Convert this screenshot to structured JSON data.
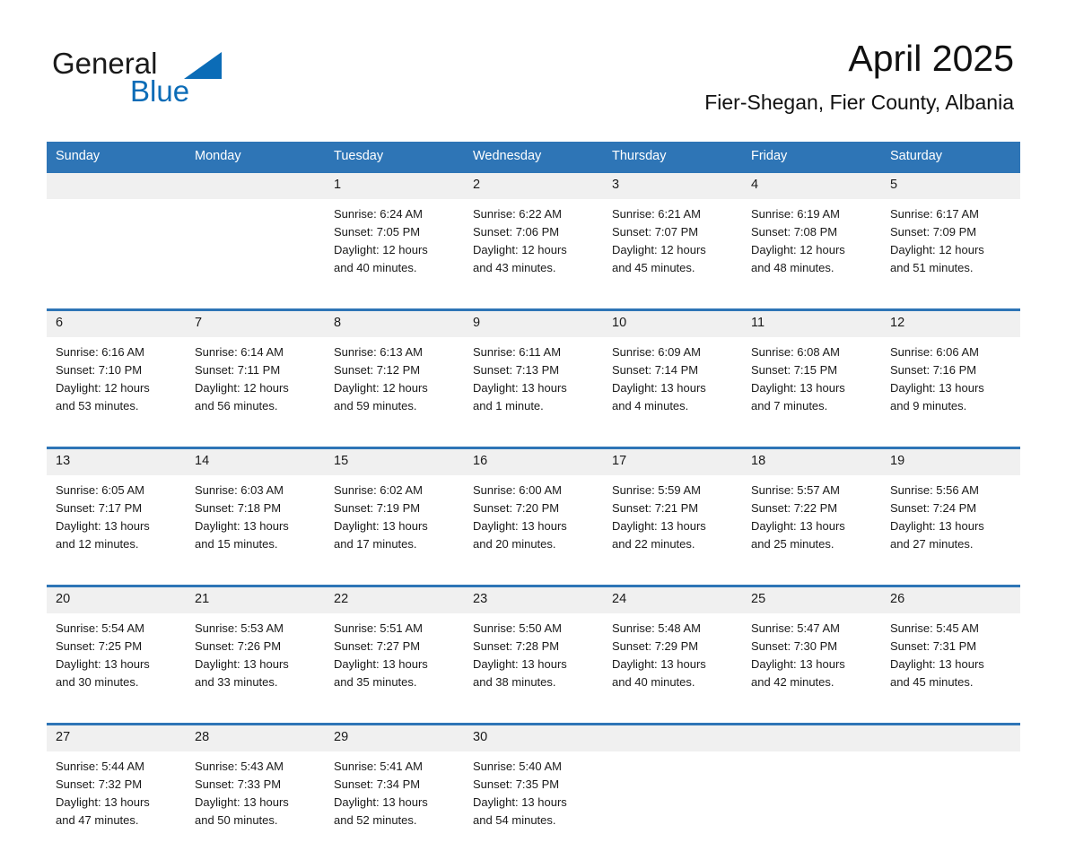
{
  "brand": {
    "name_part1": "General",
    "name_part2": "Blue",
    "triangle_icon": "triangle-icon",
    "accent_color": "#0b6cb7"
  },
  "header": {
    "title": "April 2025",
    "subtitle": "Fier-Shegan, Fier County, Albania"
  },
  "calendar": {
    "header_bg": "#2e75b6",
    "daynum_bg": "#f0f0f0",
    "weekdays": [
      "Sunday",
      "Monday",
      "Tuesday",
      "Wednesday",
      "Thursday",
      "Friday",
      "Saturday"
    ],
    "weeks": [
      [
        {
          "day": "",
          "sunrise": "",
          "sunset": "",
          "daylight1": "",
          "daylight2": ""
        },
        {
          "day": "",
          "sunrise": "",
          "sunset": "",
          "daylight1": "",
          "daylight2": ""
        },
        {
          "day": "1",
          "sunrise": "Sunrise: 6:24 AM",
          "sunset": "Sunset: 7:05 PM",
          "daylight1": "Daylight: 12 hours",
          "daylight2": "and 40 minutes."
        },
        {
          "day": "2",
          "sunrise": "Sunrise: 6:22 AM",
          "sunset": "Sunset: 7:06 PM",
          "daylight1": "Daylight: 12 hours",
          "daylight2": "and 43 minutes."
        },
        {
          "day": "3",
          "sunrise": "Sunrise: 6:21 AM",
          "sunset": "Sunset: 7:07 PM",
          "daylight1": "Daylight: 12 hours",
          "daylight2": "and 45 minutes."
        },
        {
          "day": "4",
          "sunrise": "Sunrise: 6:19 AM",
          "sunset": "Sunset: 7:08 PM",
          "daylight1": "Daylight: 12 hours",
          "daylight2": "and 48 minutes."
        },
        {
          "day": "5",
          "sunrise": "Sunrise: 6:17 AM",
          "sunset": "Sunset: 7:09 PM",
          "daylight1": "Daylight: 12 hours",
          "daylight2": "and 51 minutes."
        }
      ],
      [
        {
          "day": "6",
          "sunrise": "Sunrise: 6:16 AM",
          "sunset": "Sunset: 7:10 PM",
          "daylight1": "Daylight: 12 hours",
          "daylight2": "and 53 minutes."
        },
        {
          "day": "7",
          "sunrise": "Sunrise: 6:14 AM",
          "sunset": "Sunset: 7:11 PM",
          "daylight1": "Daylight: 12 hours",
          "daylight2": "and 56 minutes."
        },
        {
          "day": "8",
          "sunrise": "Sunrise: 6:13 AM",
          "sunset": "Sunset: 7:12 PM",
          "daylight1": "Daylight: 12 hours",
          "daylight2": "and 59 minutes."
        },
        {
          "day": "9",
          "sunrise": "Sunrise: 6:11 AM",
          "sunset": "Sunset: 7:13 PM",
          "daylight1": "Daylight: 13 hours",
          "daylight2": "and 1 minute."
        },
        {
          "day": "10",
          "sunrise": "Sunrise: 6:09 AM",
          "sunset": "Sunset: 7:14 PM",
          "daylight1": "Daylight: 13 hours",
          "daylight2": "and 4 minutes."
        },
        {
          "day": "11",
          "sunrise": "Sunrise: 6:08 AM",
          "sunset": "Sunset: 7:15 PM",
          "daylight1": "Daylight: 13 hours",
          "daylight2": "and 7 minutes."
        },
        {
          "day": "12",
          "sunrise": "Sunrise: 6:06 AM",
          "sunset": "Sunset: 7:16 PM",
          "daylight1": "Daylight: 13 hours",
          "daylight2": "and 9 minutes."
        }
      ],
      [
        {
          "day": "13",
          "sunrise": "Sunrise: 6:05 AM",
          "sunset": "Sunset: 7:17 PM",
          "daylight1": "Daylight: 13 hours",
          "daylight2": "and 12 minutes."
        },
        {
          "day": "14",
          "sunrise": "Sunrise: 6:03 AM",
          "sunset": "Sunset: 7:18 PM",
          "daylight1": "Daylight: 13 hours",
          "daylight2": "and 15 minutes."
        },
        {
          "day": "15",
          "sunrise": "Sunrise: 6:02 AM",
          "sunset": "Sunset: 7:19 PM",
          "daylight1": "Daylight: 13 hours",
          "daylight2": "and 17 minutes."
        },
        {
          "day": "16",
          "sunrise": "Sunrise: 6:00 AM",
          "sunset": "Sunset: 7:20 PM",
          "daylight1": "Daylight: 13 hours",
          "daylight2": "and 20 minutes."
        },
        {
          "day": "17",
          "sunrise": "Sunrise: 5:59 AM",
          "sunset": "Sunset: 7:21 PM",
          "daylight1": "Daylight: 13 hours",
          "daylight2": "and 22 minutes."
        },
        {
          "day": "18",
          "sunrise": "Sunrise: 5:57 AM",
          "sunset": "Sunset: 7:22 PM",
          "daylight1": "Daylight: 13 hours",
          "daylight2": "and 25 minutes."
        },
        {
          "day": "19",
          "sunrise": "Sunrise: 5:56 AM",
          "sunset": "Sunset: 7:24 PM",
          "daylight1": "Daylight: 13 hours",
          "daylight2": "and 27 minutes."
        }
      ],
      [
        {
          "day": "20",
          "sunrise": "Sunrise: 5:54 AM",
          "sunset": "Sunset: 7:25 PM",
          "daylight1": "Daylight: 13 hours",
          "daylight2": "and 30 minutes."
        },
        {
          "day": "21",
          "sunrise": "Sunrise: 5:53 AM",
          "sunset": "Sunset: 7:26 PM",
          "daylight1": "Daylight: 13 hours",
          "daylight2": "and 33 minutes."
        },
        {
          "day": "22",
          "sunrise": "Sunrise: 5:51 AM",
          "sunset": "Sunset: 7:27 PM",
          "daylight1": "Daylight: 13 hours",
          "daylight2": "and 35 minutes."
        },
        {
          "day": "23",
          "sunrise": "Sunrise: 5:50 AM",
          "sunset": "Sunset: 7:28 PM",
          "daylight1": "Daylight: 13 hours",
          "daylight2": "and 38 minutes."
        },
        {
          "day": "24",
          "sunrise": "Sunrise: 5:48 AM",
          "sunset": "Sunset: 7:29 PM",
          "daylight1": "Daylight: 13 hours",
          "daylight2": "and 40 minutes."
        },
        {
          "day": "25",
          "sunrise": "Sunrise: 5:47 AM",
          "sunset": "Sunset: 7:30 PM",
          "daylight1": "Daylight: 13 hours",
          "daylight2": "and 42 minutes."
        },
        {
          "day": "26",
          "sunrise": "Sunrise: 5:45 AM",
          "sunset": "Sunset: 7:31 PM",
          "daylight1": "Daylight: 13 hours",
          "daylight2": "and 45 minutes."
        }
      ],
      [
        {
          "day": "27",
          "sunrise": "Sunrise: 5:44 AM",
          "sunset": "Sunset: 7:32 PM",
          "daylight1": "Daylight: 13 hours",
          "daylight2": "and 47 minutes."
        },
        {
          "day": "28",
          "sunrise": "Sunrise: 5:43 AM",
          "sunset": "Sunset: 7:33 PM",
          "daylight1": "Daylight: 13 hours",
          "daylight2": "and 50 minutes."
        },
        {
          "day": "29",
          "sunrise": "Sunrise: 5:41 AM",
          "sunset": "Sunset: 7:34 PM",
          "daylight1": "Daylight: 13 hours",
          "daylight2": "and 52 minutes."
        },
        {
          "day": "30",
          "sunrise": "Sunrise: 5:40 AM",
          "sunset": "Sunset: 7:35 PM",
          "daylight1": "Daylight: 13 hours",
          "daylight2": "and 54 minutes."
        },
        {
          "day": "",
          "sunrise": "",
          "sunset": "",
          "daylight1": "",
          "daylight2": ""
        },
        {
          "day": "",
          "sunrise": "",
          "sunset": "",
          "daylight1": "",
          "daylight2": ""
        },
        {
          "day": "",
          "sunrise": "",
          "sunset": "",
          "daylight1": "",
          "daylight2": ""
        }
      ]
    ]
  }
}
